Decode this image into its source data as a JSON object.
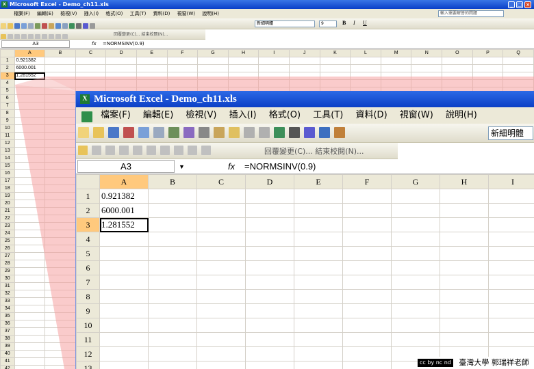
{
  "app": {
    "title": "Microsoft Excel - Demo_ch11.xls",
    "menu": [
      "檔案(F)",
      "編輯(E)",
      "檢視(V)",
      "插入(I)",
      "格式(O)",
      "工具(T)",
      "資料(D)",
      "視窗(W)",
      "說明(H)"
    ],
    "help_placeholder": "輸入需要解答的問題",
    "font_name": "新細明體",
    "font_size": "9",
    "review_label": "回覆變更(C)... 結束校閱(N)..."
  },
  "formula_bar": {
    "name_box": "A3",
    "fx": "fx",
    "formula": "=NORMSINV(0.9)"
  },
  "zoom": {
    "title": "Microsoft Excel - Demo_ch11.xls",
    "font_name": "新細明體",
    "review_label": "回覆變更(C)... 結束校閱(N)..."
  },
  "columns_small": [
    "A",
    "B",
    "C",
    "D",
    "E",
    "F",
    "G",
    "H",
    "I",
    "J",
    "K",
    "L",
    "M",
    "N",
    "O",
    "P",
    "Q"
  ],
  "columns_big": [
    "A",
    "B",
    "C",
    "D",
    "E",
    "F",
    "G",
    "H",
    "I"
  ],
  "cells": [
    "0.921382",
    "6000.001",
    "1.281552"
  ],
  "footer": {
    "credit": "臺灣大學 郭瑞祥老師",
    "license": "cc by nc nd"
  },
  "colors": {
    "accent": "#0b3fc6",
    "selected_header": "#ffc97d",
    "callout": "#f6a0a0"
  }
}
